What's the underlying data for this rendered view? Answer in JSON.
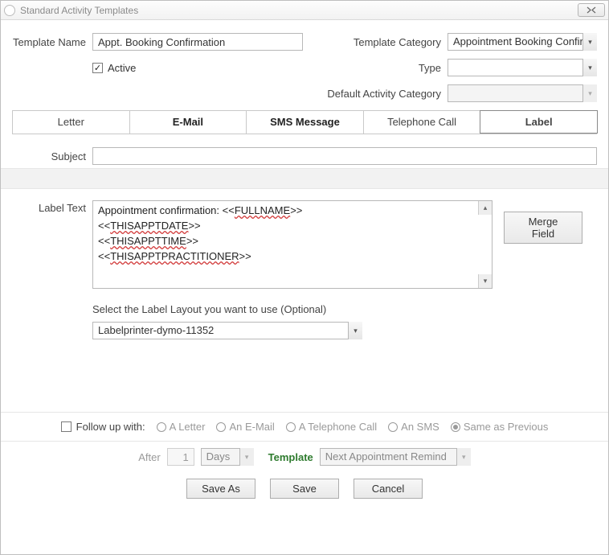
{
  "window": {
    "title": "Standard Activity Templates"
  },
  "form": {
    "templateNameLabel": "Template Name",
    "templateNameValue": "Appt. Booking Confirmation",
    "activeLabel": "Active",
    "activeChecked": true,
    "templateCategoryLabel": "Template Category",
    "templateCategoryValue": "Appointment Booking Confirmat",
    "typeLabel": "Type",
    "typeValue": "",
    "defaultActivityCategoryLabel": "Default Activity Category",
    "defaultActivityCategoryValue": ""
  },
  "tabs": {
    "letter": "Letter",
    "email": "E-Mail",
    "sms": "SMS Message",
    "telephone": "Telephone Call",
    "label": "Label"
  },
  "subject": {
    "label": "Subject",
    "value": ""
  },
  "labelPanel": {
    "labelTextLabel": "Label Text",
    "line1_prefix": "Appointment confirmation: <<",
    "line1_token": "FULLNAME",
    "line1_suffix": ">>",
    "line2_prefix": "<<",
    "line2_token": "THISAPPTDATE",
    "line2_suffix": ">>",
    "line3_prefix": "<<",
    "line3_token": "THISAPPTTIME",
    "line3_suffix": ">>",
    "line4_prefix": "<<",
    "line4_token": "THISAPPTPRACTITIONER",
    "line4_suffix": ">>",
    "mergeFieldBtn": "Merge Field",
    "layoutHint": "Select the Label Layout you want to use (Optional)",
    "layoutValue": "Labelprinter-dymo-11352"
  },
  "followup": {
    "label": "Follow up with:",
    "optLetter": "A Letter",
    "optEmail": "An E-Mail",
    "optTelephone": "A Telephone Call",
    "optSMS": "An SMS",
    "optSame": "Same as Previous",
    "afterLabel": "After",
    "afterValue": "1",
    "unitValue": "Days",
    "templateLabel": "Template",
    "templateValue": "Next Appointment Remind"
  },
  "footer": {
    "saveAs": "Save As",
    "save": "Save",
    "cancel": "Cancel"
  }
}
